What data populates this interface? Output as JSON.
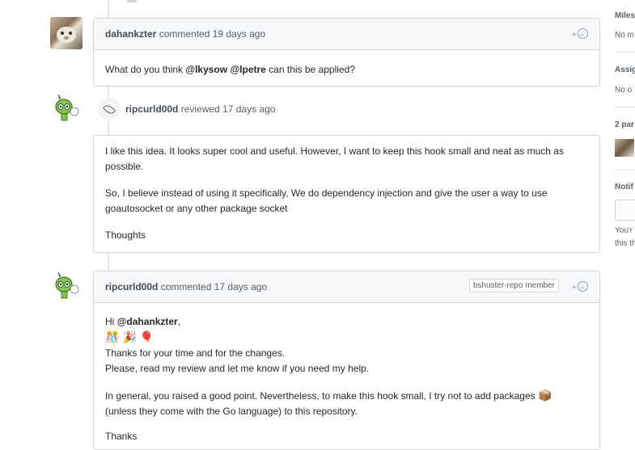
{
  "comments": [
    {
      "author": "dahankzter",
      "action": "commented",
      "time": "19 days ago",
      "body_prefix": "What do you think ",
      "mention1": "@lkysow",
      "mention2": "@lpetre",
      "body_suffix": " can this be applied?"
    }
  ],
  "review": {
    "author": "ripcurld00d",
    "action": "reviewed",
    "time": "17 days ago",
    "paragraphs": [
      "I like this idea. It looks super cool and useful. However, I want to keep this hook small and neat as much as possible.",
      "So, I believe instead of using it specifically, We do dependency injection and give the user a way to use goautosocket or any other package socket",
      "Thoughts"
    ]
  },
  "comment2": {
    "author": "ripcurld00d",
    "action": "commented",
    "time": "17 days ago",
    "badge": "bshuster-repo member",
    "greeting": "Hi ",
    "greeting_mention": "@dahankzter",
    "greeting_suffix": ",",
    "emojis": [
      "🎊",
      "🎉",
      "🎈"
    ],
    "line1": "Thanks for your time and for the changes.",
    "line2": "Please, read my review and let me know if you need my help.",
    "para2": "In general, you raised a good point. Nevertheless, to make this hook small, I try not to add packages",
    "para2_emoji": "📦",
    "para2_cont": "(unless they come with the Go language) to this repository.",
    "closing": "Thanks"
  },
  "reaction": {
    "plus": "+"
  },
  "sidebar": {
    "milestone_heading": "Miles",
    "milestone_value": "No m",
    "assignees_heading": "Assig",
    "assignees_value": "No o",
    "participants_heading": "2 par",
    "notifications_heading": "Notif",
    "notifications_text1": "You'r",
    "notifications_text2": "this th"
  }
}
